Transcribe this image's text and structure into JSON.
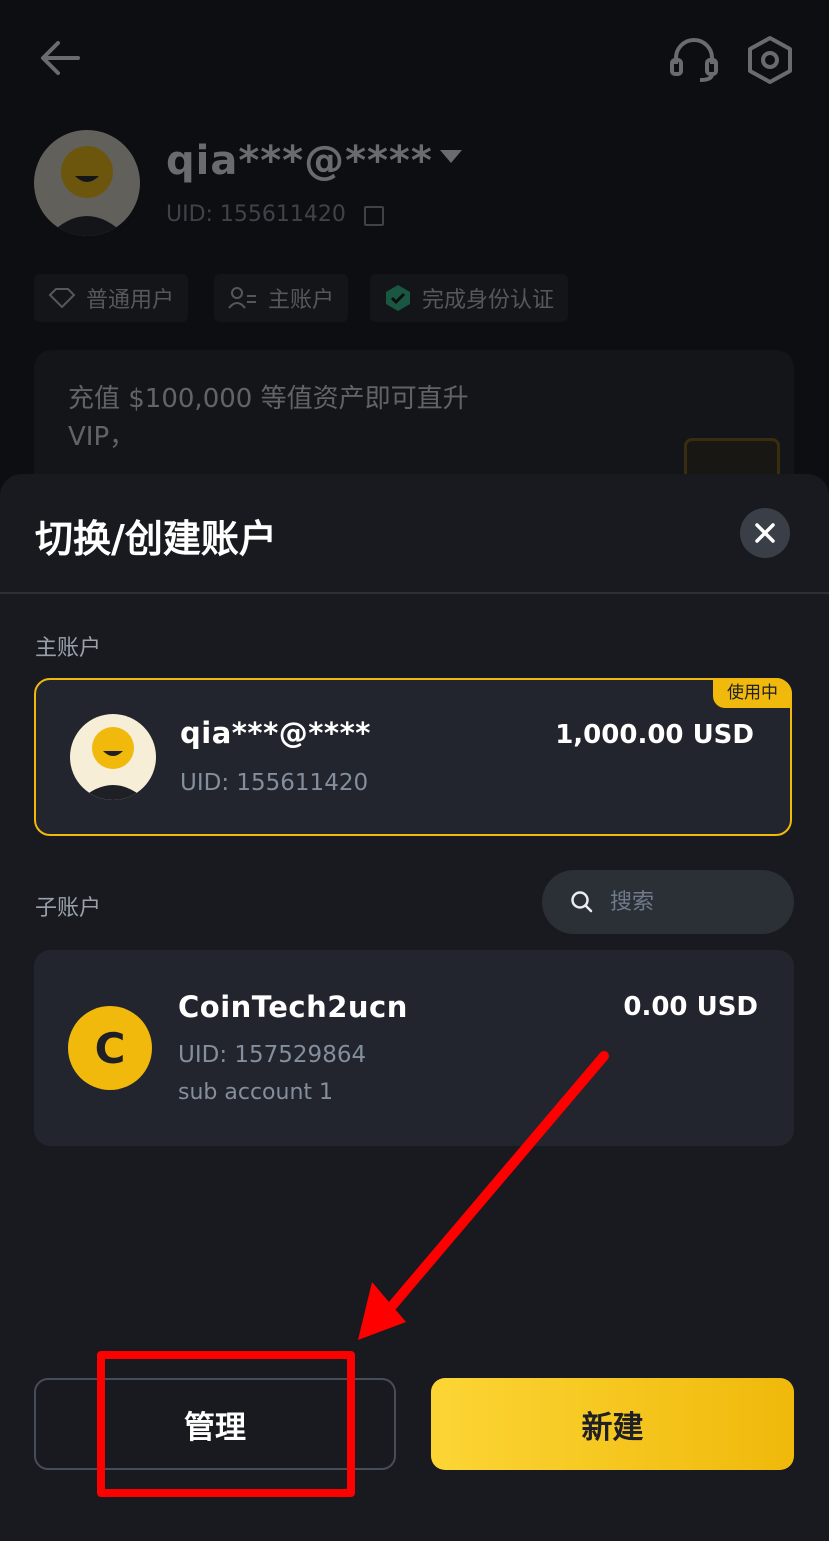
{
  "profile": {
    "username": "qia***@****",
    "uid": "UID: 155611420",
    "tags": [
      "普通用户",
      "主账户",
      "完成身份认证"
    ],
    "vip_promo": "充值 $100,000 等值资产即可直升 VIP，"
  },
  "sheet": {
    "title": "切换/创建账户",
    "main_section_label": "主账户",
    "sub_section_label": "子账户",
    "search_placeholder": "搜索",
    "main_account": {
      "name": "qia***@****",
      "uid": "UID: 155611420",
      "balance": "1,000.00 USD",
      "badge": "使用中"
    },
    "sub_accounts": [
      {
        "initial": "C",
        "name": "CoinTech2ucn",
        "uid": "UID: 157529864",
        "remark": "sub account 1",
        "balance": "0.00 USD"
      }
    ],
    "manage_label": "管理",
    "new_label": "新建"
  },
  "colors": {
    "accent": "#f0b90b",
    "annotation": "#ff0000",
    "background": "#181a20"
  },
  "icons": [
    "back-arrow-icon",
    "headset-icon",
    "settings-hexagon-icon",
    "close-icon",
    "search-icon",
    "diamond-icon",
    "user-switch-icon",
    "verified-check-icon"
  ]
}
